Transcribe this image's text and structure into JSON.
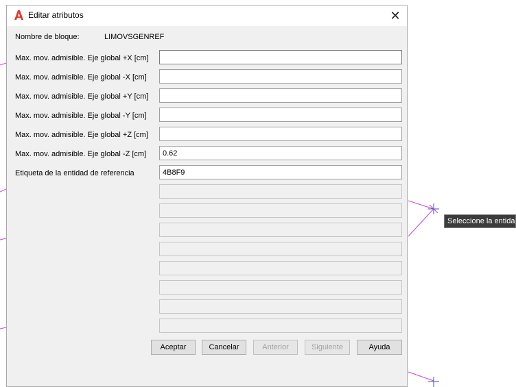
{
  "dialog": {
    "title": "Editar atributos",
    "close_label": "✕",
    "block_name_label": "Nombre de bloque:",
    "block_name_value": "LIMOVSGENREF"
  },
  "attributes": [
    {
      "label": "Max. mov. admisible. Eje global +X [cm]",
      "value": ""
    },
    {
      "label": "Max. mov. admisible. Eje global -X [cm]",
      "value": ""
    },
    {
      "label": "Max. mov. admisible. Eje global +Y [cm]",
      "value": ""
    },
    {
      "label": "Max. mov. admisible. Eje global -Y [cm]",
      "value": ""
    },
    {
      "label": "Max. mov. admisible. Eje global +Z [cm]",
      "value": ""
    },
    {
      "label": "Max. mov. admisible. Eje global -Z [cm]",
      "value": "0.62"
    },
    {
      "label": "Etiqueta de la entidad de referencia",
      "value": "4B8F9"
    }
  ],
  "buttons": {
    "accept": "Aceptar",
    "cancel": "Cancelar",
    "previous": "Anterior",
    "next": "Siguiente",
    "help": "Ayuda"
  },
  "tooltip": "Seleccione la entidad:",
  "colors": {
    "app_icon": "#e23b2e",
    "canvas_line": "#cc44cc",
    "crosshair": "#3355bb"
  },
  "icons": {
    "app": "autocad-a-icon",
    "close": "close-icon"
  }
}
